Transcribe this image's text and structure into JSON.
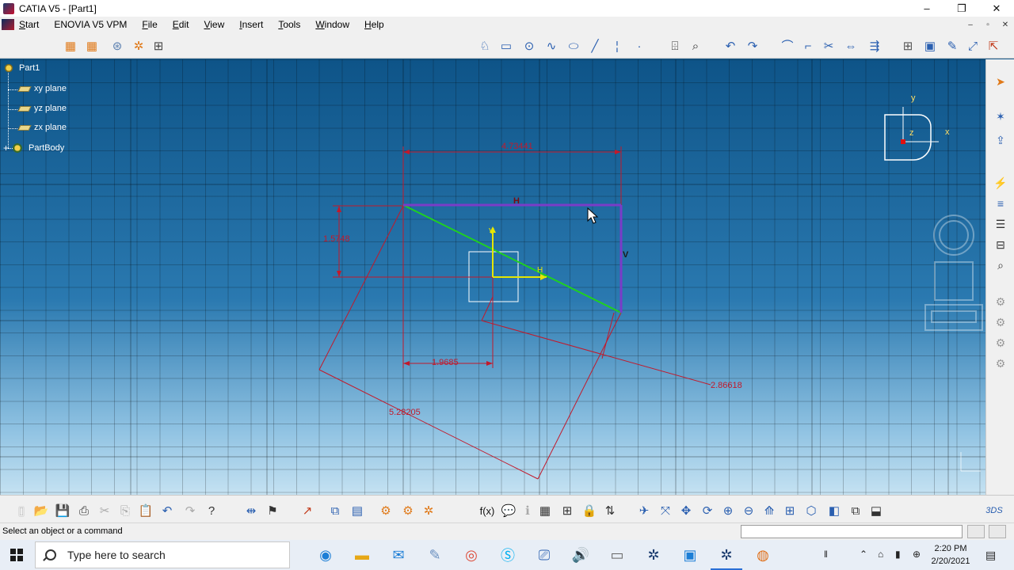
{
  "window": {
    "title": "CATIA V5 - [Part1]",
    "controls": [
      "–",
      "❐",
      "✕"
    ],
    "mdi_controls": [
      "–",
      "▫",
      "✕"
    ]
  },
  "menu": {
    "items": [
      "Start",
      "ENOVIA V5 VPM",
      "File",
      "Edit",
      "View",
      "Insert",
      "Tools",
      "Window",
      "Help"
    ]
  },
  "tree": {
    "root": "Part1",
    "children": [
      "xy plane",
      "yz plane",
      "zx plane",
      "PartBody"
    ]
  },
  "sketch": {
    "dimensions": {
      "width": "4.73441",
      "height": "1.5748",
      "offset": "1.9685",
      "diag": "5.28205",
      "side": "2.86618"
    },
    "constraint_h": "H",
    "constraint_v": "V",
    "axis_h": "H",
    "axis_v": "V"
  },
  "compass": {
    "x": "x",
    "y": "y",
    "z": "z"
  },
  "status": {
    "message": "Select an object or a command",
    "command_value": ""
  },
  "taskbar": {
    "search_placeholder": "Type here to search",
    "time": "2:20 PM",
    "date": "2/20/2021"
  },
  "colors": {
    "sketch_dim": "#c2192b",
    "constraint_line": "#7a3cc8",
    "construction_line": "#1fd11f",
    "axis": "#e6e600"
  },
  "icons": {
    "top_toolbar": [
      "grid-icon",
      "snap-grid-icon",
      "construction-icon",
      "geometric-constraint-icon",
      "dimensional-constraint-icon",
      "profile-icon",
      "rectangle-icon",
      "circle-icon",
      "spline-icon",
      "ellipse-icon",
      "line-icon",
      "axis-icon",
      "point-icon",
      "constraint-icon",
      "analysis-icon",
      "undo-sketch-icon",
      "redo-sketch-icon",
      "corner-icon",
      "chamfer-icon",
      "trim-icon",
      "mirror-icon",
      "project-icon",
      "create-table-icon",
      "part-design-icon",
      "sketch-edit-icon",
      "sketch-analysis-icon",
      "exit-sketcher-icon"
    ],
    "right_toolbar": [
      "select-icon",
      "sketch-tools-icon",
      "exit-workbench-icon",
      "constraint-display-icon",
      "list-icon",
      "hierarchy-icon",
      "tree-icon",
      "search-icon",
      "gear-icon",
      "gear-icon",
      "gear-icon",
      "gear-icon"
    ],
    "bottom_toolbar": [
      "new-icon",
      "open-icon",
      "save-icon",
      "print-icon",
      "cut-icon",
      "copy-icon",
      "paste-icon",
      "undo-icon",
      "redo-icon",
      "whats-this-icon",
      "measure-icon",
      "flag-icon",
      "publish-icon",
      "catalog-icon",
      "scan-icon",
      "knowledge-icon",
      "formula-icon",
      "comment-icon",
      "tolerance-icon",
      "table-icon",
      "hierarchy-icon",
      "lock-icon",
      "parameter-icon",
      "fly-icon",
      "fit-all-icon",
      "pan-icon",
      "rotate-icon",
      "zoom-in-icon",
      "zoom-out-icon",
      "normal-view-icon",
      "multiview-icon",
      "iso-view-icon",
      "render-style-icon",
      "hide-show-icon",
      "swap-visible-icon"
    ],
    "taskbar": [
      "edge-icon",
      "folder-icon",
      "mail-icon",
      "paint-icon",
      "chrome-icon",
      "skype-icon",
      "network-icon",
      "audio-icon",
      "catalog-icon",
      "catia-icon",
      "display-icon",
      "catia-icon",
      "orange-app-icon"
    ]
  }
}
